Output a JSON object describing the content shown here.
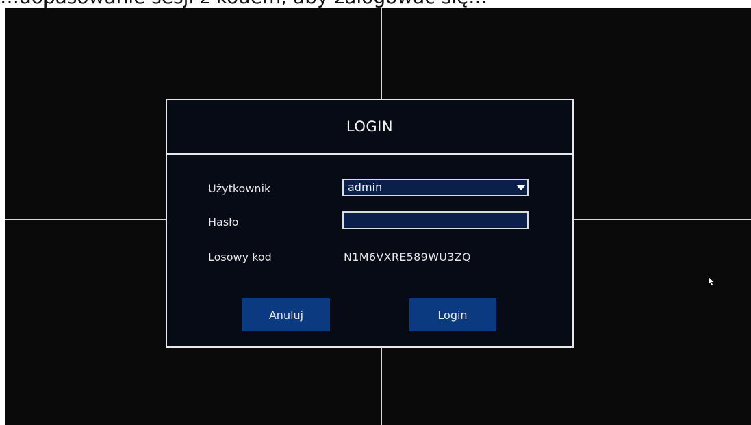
{
  "caption": "…dopasowanie sesji z kodem, aby zalogować się…",
  "dialog": {
    "title": "LOGIN",
    "username_label": "Użytkownik",
    "username_value": "admin",
    "password_label": "Hasło",
    "password_value": "",
    "random_code_label": "Losowy kod",
    "random_code_value": "N1M6VXRE589WU3ZQ",
    "cancel_label": "Anuluj",
    "login_label": "Login"
  },
  "icons": {
    "dropdown": "chevron-down-icon",
    "cursor": "mouse-pointer-icon"
  },
  "colors": {
    "background": "#0a0a0a",
    "dialog_bg": "#060b16",
    "input_bg": "#0a1f4a",
    "button_bg": "#0c3a80",
    "border": "#e8e8e8"
  }
}
